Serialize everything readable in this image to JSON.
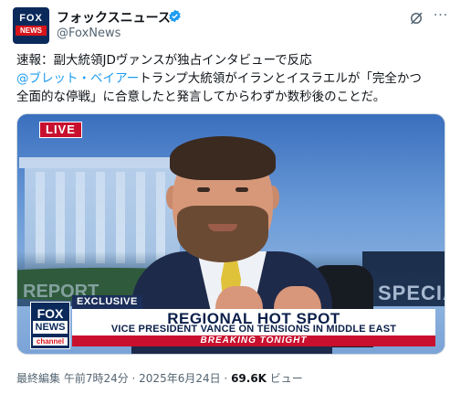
{
  "account": {
    "name": "フォックスニュース",
    "handle": "@FoxNews",
    "avatar_text_top": "FOX",
    "avatar_text_bottom": "NEWS",
    "verified_icon": "verified-badge-icon",
    "verified_color": "#1d9bf0"
  },
  "actions": {
    "grok_icon": "grok-icon",
    "more_icon": "more-icon"
  },
  "tweet": {
    "line1": "速報：副大統領JDヴァンスが独占インタビューで反応",
    "mention": "@ブレット・ベイアー",
    "line2_rest": "トランプ大統領がイランとイスラエルが「完全かつ",
    "line3": "全面的な停戦」に合意したと発言してからわずか数秒後のことだ。",
    "mention_color": "#1d9bf0"
  },
  "media": {
    "live_label": "LIVE",
    "exclusive_label": "EXCLUSIVE",
    "headline": "REGIONAL HOT SPOT",
    "subheadline": "VICE PRESIDENT VANCE ON TENSIONS IN MIDDLE EAST",
    "breaking_label": "BREAKING TONIGHT",
    "logo_fox": "FOX",
    "logo_news": "NEWS",
    "logo_channel": "channel",
    "background_left_text": "REPORT",
    "background_right_text": "SPECIA"
  },
  "meta": {
    "edited_time": "最終編集 午前7時24分 · 2025年6月24日 · ",
    "views_count": "69.6K",
    "views_label": " ビュー"
  }
}
